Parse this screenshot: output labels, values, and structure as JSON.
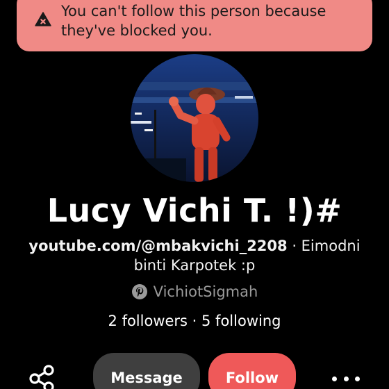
{
  "toast": {
    "message": "You can't follow this person because\nthey've blocked you.",
    "icon": "warning-x-icon",
    "background_color": "#f08a86"
  },
  "profile": {
    "avatar": "profile-photo-wooden-mannequin",
    "name": "Lucy Vichi T. !)#",
    "bio_link": "youtube.com/@mbakvichi_2208",
    "bio_text": " · Eimodni binti Karpotek :p",
    "username": "VichiotSigmah",
    "username_icon": "pinterest-icon",
    "stats": "2 followers · 5 following"
  },
  "actions": {
    "share_icon": "share-icon",
    "message_label": "Message",
    "follow_label": "Follow",
    "more_icon": "more-dots-icon",
    "follow_color": "#ef5959",
    "message_color": "#3f3f3f"
  }
}
